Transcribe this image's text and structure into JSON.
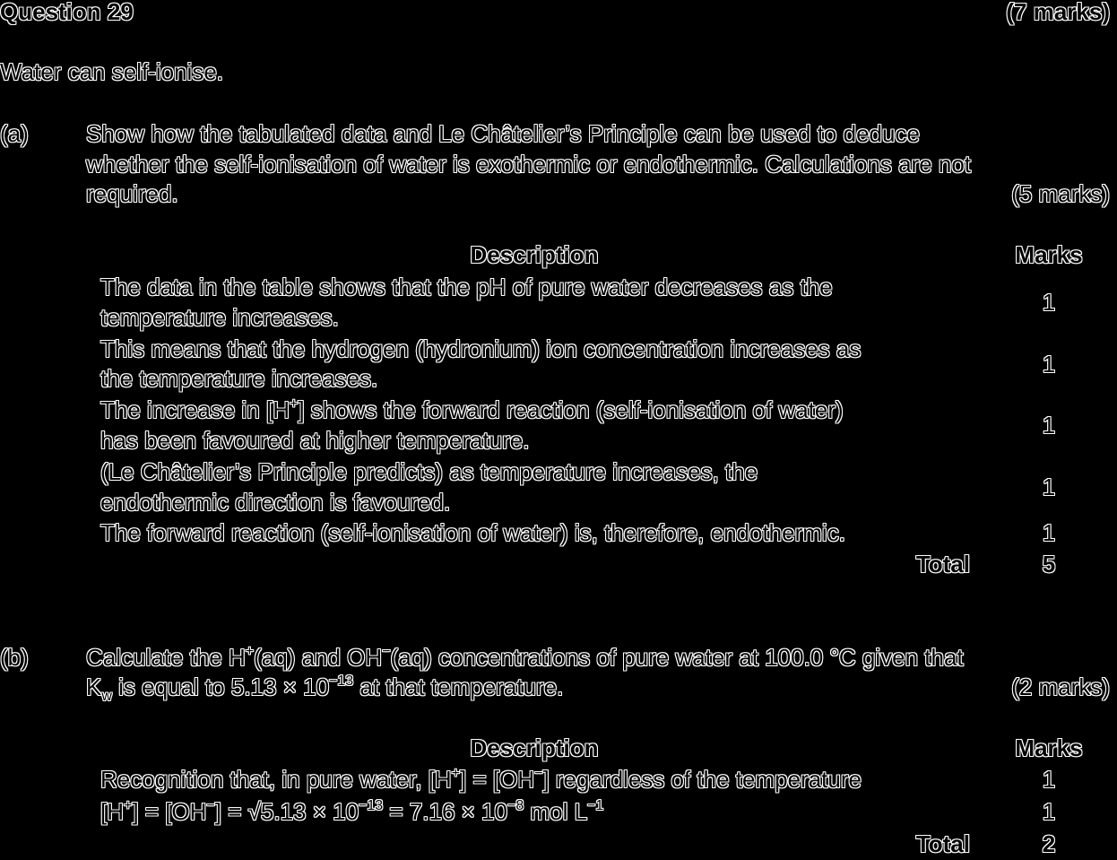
{
  "question": {
    "title": "Question 29",
    "marks": "(7 marks)",
    "intro": "Water can self-ionise."
  },
  "part_a": {
    "label": "(a)",
    "prompt_lines": [
      "Show how the tabulated data and Le Châtelier’s Principle can be used to deduce",
      "whether the self-ionisation of water is exothermic or endothermic. Calculations are not",
      "required."
    ],
    "marks": "(5 marks)",
    "table": {
      "header_description": "Description",
      "header_marks": "Marks",
      "rows": [
        {
          "lines": [
            "The data in the table shows that the pH of pure water decreases as the",
            "temperature increases."
          ],
          "mark": "1"
        },
        {
          "lines": [
            "This means that the hydrogen (hydronium) ion concentration increases as",
            "the temperature increases."
          ],
          "mark": "1"
        },
        {
          "line1_pre": "The increase in [H",
          "line1_sup": "+",
          "line1_post": "] shows the forward reaction (self-ionisation of water)",
          "line2": "has been favoured at higher temperature.",
          "mark": "1"
        },
        {
          "lines": [
            "(Le Châtelier’s Principle predicts) as temperature increases, the",
            "endothermic direction is favoured."
          ],
          "mark": "1"
        },
        {
          "lines": [
            "The forward reaction (self-ionisation of water) is, therefore, endothermic."
          ],
          "mark": "1"
        }
      ],
      "total_label": "Total",
      "total_value": "5"
    }
  },
  "part_b": {
    "label": "(b)",
    "prompt_line1": {
      "pre": "Calculate the H",
      "sup1": "+",
      "mid": "(aq) and OH",
      "sup2": "−",
      "post": "(aq) concentrations of pure water at 100.0 °C given that"
    },
    "prompt_line2": {
      "pre": "K",
      "sub": "w",
      "mid": " is equal to 5.13 × 10",
      "sup": "−13",
      "post": " at that temperature."
    },
    "marks": "(2 marks)",
    "table": {
      "header_description": "Description",
      "header_marks": "Marks",
      "row1": {
        "pre": "Recognition that, in pure water, [H",
        "sup1": "+",
        "mid": "] = [OH",
        "sup2": "−",
        "post": "] regardless of the temperature",
        "mark": "1"
      },
      "row2": {
        "a": "[H",
        "sup1": "+",
        "b": "] = [OH",
        "sup2": "−",
        "c": "] = √5.13 × 10",
        "sup3": "−13",
        "d": " = 7.16 × 10",
        "sup4": "−8",
        "e": " mol L",
        "sup5": "−1",
        "mark": "1"
      },
      "total_label": "Total",
      "total_value": "2"
    }
  }
}
